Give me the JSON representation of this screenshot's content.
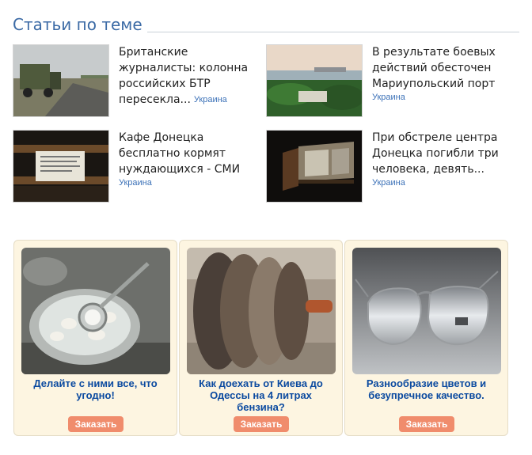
{
  "section": {
    "title": "Статьи по теме"
  },
  "articles": [
    {
      "title": "Британские журналисты: колонна российских БТР пересекла...",
      "tag": "Украина",
      "thumb_icon": "military-truck-road-photo"
    },
    {
      "title": "В результате боевых действий обесточен Мариупольский порт",
      "tag": "Украина",
      "thumb_icon": "port-landscape-photo"
    },
    {
      "title": "Кафе Донецка бесплатно кормят нуждающихся - СМИ",
      "tag": "Украина",
      "thumb_icon": "cafe-notice-photo"
    },
    {
      "title": "При обстреле центра Донецка погибли три человека, девять...",
      "tag": "Украина",
      "thumb_icon": "broken-window-photo"
    }
  ],
  "ads": [
    {
      "text": "Делайте с ними все, что угодно!",
      "button": "Заказать",
      "image_icon": "watch-in-pot-photo"
    },
    {
      "text": "Как доехать от Киева до Одессы на 4 литрах бензина?",
      "button": "Заказать",
      "image_icon": "metal-pulley-photo"
    },
    {
      "text": "Разнообразие цветов и безупречное качество.",
      "button": "Заказать",
      "image_icon": "aviator-sunglasses-photo"
    }
  ],
  "colors": {
    "accent": "#3b6aa5",
    "tag": "#3d72b8",
    "ad_bg": "#fdf5e1",
    "ad_text": "#0b4aa0",
    "button": "#f08c6c"
  }
}
